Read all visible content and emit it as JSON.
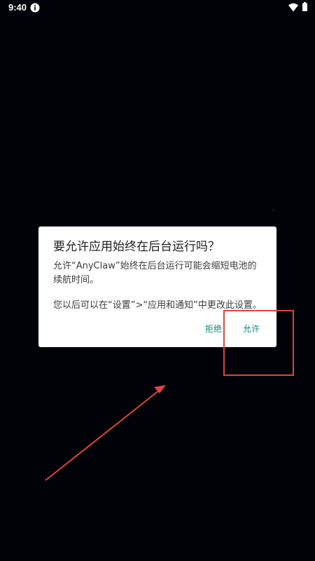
{
  "status_bar": {
    "time": "9:40",
    "icons": [
      "info-icon",
      "wifi-icon",
      "battery-icon"
    ]
  },
  "dialog": {
    "title": "要允许应用始终在后台运行吗？",
    "message": "允许“AnyClaw”始终在后台运行可能会缩短电池的续航时间。",
    "note": "您以后可以在“设置”>“应用和通知”中更改此设置。",
    "deny_label": "拒绝",
    "allow_label": "允许"
  },
  "annotation": {
    "highlight_color": "#e0443a",
    "arrow_color": "#e0443a"
  },
  "colors": {
    "background": "#010208",
    "dialog_background": "#ffffff",
    "button_accent": "#0b8a7a"
  }
}
